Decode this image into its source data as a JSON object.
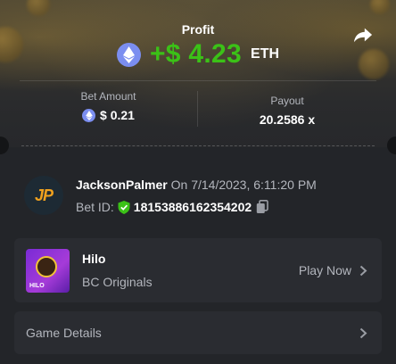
{
  "header": {
    "profit_label": "Profit",
    "profit_value": "+$ 4.23",
    "profit_currency": "ETH",
    "profit_color": "#3bc117",
    "share_icon": "share-arrow-icon"
  },
  "stats": {
    "bet_amount_label": "Bet Amount",
    "bet_amount_value": "$ 0.21",
    "payout_label": "Payout",
    "payout_value": "20.2586 x"
  },
  "user": {
    "avatar_text": "JP",
    "name": "JacksonPalmer",
    "date": "On 7/14/2023, 6:11:20 PM",
    "bet_id_label": "Bet ID:",
    "bet_id_value": "18153886162354202"
  },
  "game": {
    "name": "Hilo",
    "provider": "BC Originals",
    "thumb_label": "HILO",
    "play_label": "Play Now"
  },
  "details": {
    "label": "Game Details"
  },
  "colors": {
    "eth": "#7b8ef0",
    "verified": "#3bc117",
    "avatar_accent": "#f0a11e"
  }
}
